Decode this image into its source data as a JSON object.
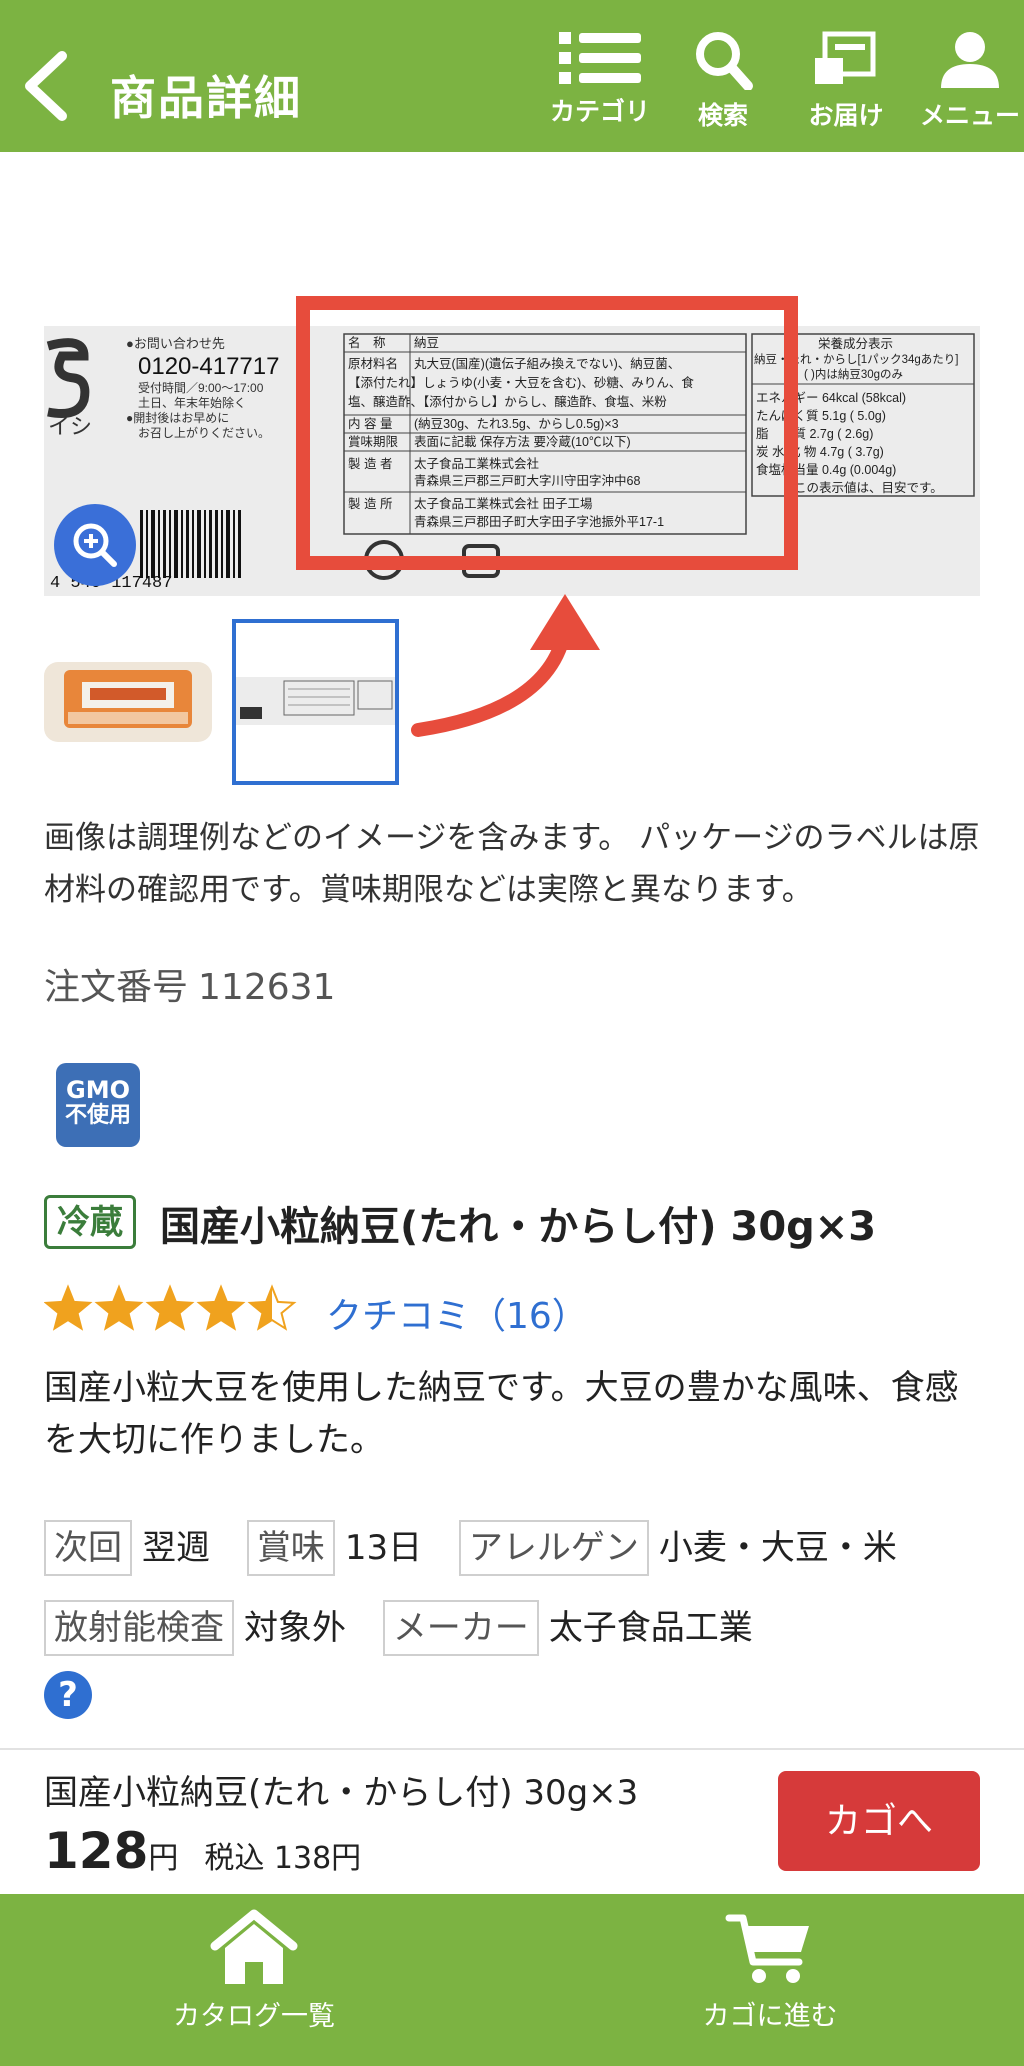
{
  "header": {
    "title": "商品詳細",
    "nav": [
      {
        "label": "カテゴリ",
        "icon": "list-icon"
      },
      {
        "label": "検索",
        "icon": "search-icon"
      },
      {
        "label": "お届け",
        "icon": "delivery-icon"
      },
      {
        "label": "メニュー",
        "icon": "user-icon"
      }
    ]
  },
  "label_image": {
    "contact_title": "●お問い合わせ先",
    "phone": "0120-417717",
    "hours": "受付時間／9:00〜17:00",
    "closed": "土日、年末年始除く",
    "note1": "●開封後はお早めに",
    "note2": "お召し上がりください。",
    "barcode": "4  540 117487",
    "label_rows": [
      {
        "k": "名　称",
        "v": "納豆"
      },
      {
        "k": "原材料名",
        "v": "丸大豆(国産)(遺伝子組み換えでない)、納豆菌、"
      },
      {
        "k": "",
        "v": "【添付たれ】しょうゆ(小麦・大豆を含む)、砂糖、みりん、食"
      },
      {
        "k": "",
        "v": "塩、醸造酢、【添付からし】からし、醸造酢、食塩、米粉"
      },
      {
        "k": "内 容 量",
        "v": "(納豆30g、たれ3.5g、からし0.5g)×3"
      },
      {
        "k": "賞味期限",
        "v": "表面に記載  保存方法  要冷蔵(10℃以下)"
      },
      {
        "k": "製 造 者",
        "v": "太子食品工業株式会社"
      },
      {
        "k": "",
        "v": "青森県三戸郡三戸町大字川守田字沖中68"
      },
      {
        "k": "製 造 所",
        "v": "太子食品工業株式会社  田子工場"
      },
      {
        "k": "",
        "v": "青森県三戸郡田子町大字田子字池振外平17-1"
      }
    ],
    "nutrition_title": "栄養成分表示",
    "nutrition_sub1": "納豆・たれ・からし[1パック34gあたり]",
    "nutrition_sub2": "( )内は納豆30gのみ",
    "nutrition": [
      "エネルギー  64kcal (58kcal)",
      "たんぱく質    5.1g (  5.0g)",
      "脂　　質    2.7g (  2.6g)",
      "炭 水 化 物    4.7g (  3.7g)",
      "食塩相当量    0.4g (0.004g)"
    ],
    "nutrition_note": "この表示値は、目安です。"
  },
  "notice": "画像は調理例などのイメージを含みます。 パッケージのラベルは原材料の確認用です。賞味期限などは実際と異なります。",
  "order": {
    "label": "注文番号",
    "value": "112631"
  },
  "gmo": {
    "line1": "GMO",
    "line2": "不使用"
  },
  "product": {
    "storage": "冷蔵",
    "name": "国産小粒納豆(たれ・からし付) 30g×3",
    "rating": 4.5,
    "reviews": "クチコミ（16）",
    "description": "国産小粒大豆を使用した納豆です。大豆の豊かな風味、食感を大切に作りました。"
  },
  "attributes": [
    {
      "tag": "次回",
      "value": "翌週"
    },
    {
      "tag": "賞味",
      "value": "13日"
    },
    {
      "tag": "アレルゲン",
      "value": "小麦・大豆・米"
    },
    {
      "tag": "放射能検査",
      "value": "対象外"
    },
    {
      "tag": "メーカー",
      "value": "太子食品工業"
    }
  ],
  "help": "?",
  "cart": {
    "name": "国産小粒納豆(たれ・からし付) 30g×3",
    "price": "128",
    "yen": "円",
    "tax_label": "税込 138円",
    "button": "カゴへ"
  },
  "footer": {
    "catalog": "カタログ一覧",
    "cart": "カゴに進む"
  },
  "colors": {
    "brand_green": "#7cb342",
    "cart_red": "#d63a3a",
    "link_blue": "#2f6fd1",
    "highlight_red": "#e74c3c"
  }
}
